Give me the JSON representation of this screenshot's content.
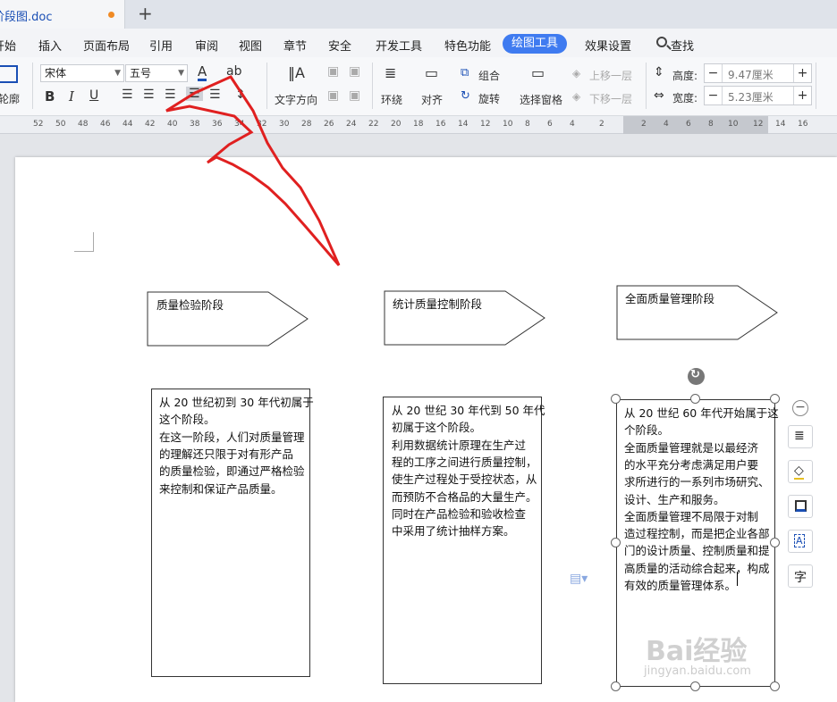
{
  "doc_tab": {
    "title": "阶段图.doc"
  },
  "menu": {
    "items": [
      "开始",
      "插入",
      "页面布局",
      "引用",
      "审阅",
      "视图",
      "章节",
      "安全",
      "开发工具",
      "特色功能"
    ],
    "active": "绘图工具",
    "after": "效果设置",
    "search": "查找"
  },
  "toolbar": {
    "outline": "轮廓",
    "font": "宋体",
    "size": "五号",
    "font_color": "A",
    "highlight": "ab",
    "bold": "B",
    "italic": "I",
    "underline": "U",
    "text_dir": "文字方向",
    "wrap": "环绕",
    "align": "对齐",
    "group": "组合",
    "rotate": "旋转",
    "select_pane": "选择窗格",
    "bring_up": "上移一层",
    "send_down": "下移一层",
    "height_label": "高度:",
    "height_value": "9.47厘米",
    "width_label": "宽度:",
    "width_value": "5.23厘米"
  },
  "ruler": {
    "left": [
      "52",
      "50",
      "48",
      "46",
      "44",
      "42",
      "40",
      "38",
      "36",
      "34",
      "32",
      "30",
      "28",
      "26",
      "24",
      "22",
      "20",
      "18",
      "16",
      "14",
      "12",
      "10",
      "8",
      "6",
      "4",
      "2"
    ],
    "right": [
      "2",
      "4",
      "6",
      "8",
      "10",
      "12",
      "14",
      "16"
    ]
  },
  "document": {
    "stages": [
      {
        "title": "质量检验阶段",
        "body": [
          "从 20 世纪初到 30 年代初属于",
          "这个阶段。",
          "在这一阶段，人们对质量管理",
          "的理解还只限于对有形产品",
          "的质量检验，即通过严格检验",
          "来控制和保证产品质量。"
        ]
      },
      {
        "title": "统计质量控制阶段",
        "body": [
          "从 20 世纪 30 年代到 50 年代",
          "初属于这个阶段。",
          "利用数据统计原理在生产过",
          "程的工序之间进行质量控制，",
          "使生产过程处于受控状态，从",
          "而预防不合格品的大量生产。",
          "同时在产品检验和验收检查",
          "中采用了统计抽样方案。"
        ]
      },
      {
        "title": "全面质量管理阶段",
        "body": [
          "从 20 世纪 60 年代开始属于这",
          "个阶段。",
          "全面质量管理就是以最经济",
          "的水平充分考虑满足用户要",
          "求所进行的一系列市场研究、",
          "设计、生产和服务。",
          "全面质量管理不局限于对制",
          "造过程控制，而是把企业各部",
          "门的设计质量、控制质量和提",
          "高质量的活动综合起来，构成",
          "有效的质量管理体系。"
        ]
      }
    ]
  },
  "watermark": {
    "brand": "Bai经验",
    "url": "jingyan.baidu.com"
  },
  "colors": {
    "accent": "#3f7bf0",
    "arrow": "#e02020",
    "tab_text": "#1a4fb5"
  }
}
